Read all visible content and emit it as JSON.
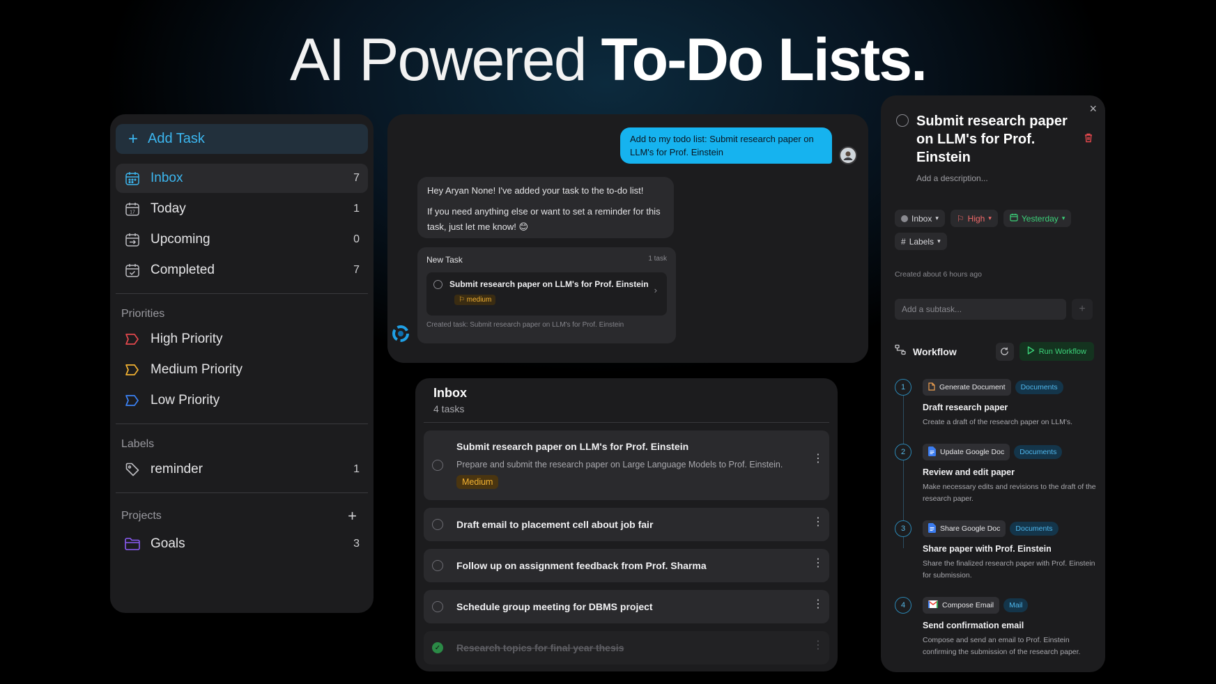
{
  "hero": {
    "light": "AI Powered",
    "bold": "To-Do Lists."
  },
  "sidebar": {
    "add_task": "Add Task",
    "nav": [
      {
        "label": "Inbox",
        "count": "7",
        "icon": "inbox-calendar-icon"
      },
      {
        "label": "Today",
        "count": "1",
        "icon": "today-calendar-icon"
      },
      {
        "label": "Upcoming",
        "count": "0",
        "icon": "upcoming-calendar-icon"
      },
      {
        "label": "Completed",
        "count": "7",
        "icon": "completed-calendar-icon"
      }
    ],
    "priorities_title": "Priorities",
    "priorities": [
      {
        "label": "High Priority",
        "color": "#e5484d"
      },
      {
        "label": "Medium Priority",
        "color": "#f3b232"
      },
      {
        "label": "Low Priority",
        "color": "#3b82f6"
      }
    ],
    "labels_title": "Labels",
    "labels": [
      {
        "label": "reminder",
        "count": "1"
      }
    ],
    "projects_title": "Projects",
    "projects": [
      {
        "label": "Goals",
        "count": "3",
        "color": "#8b5cf6"
      }
    ]
  },
  "chat": {
    "user_message": "Add to my todo list: Submit research paper on LLM's for Prof. Einstein",
    "bot_message_1": "Hey Aryan None! I've added your task to the to-do list!",
    "bot_message_2": "If you need anything else or want to set a reminder for this task, just let me know! 😊",
    "card": {
      "title": "New Task",
      "count": "1 task",
      "task_title": "Submit research paper on LLM's for Prof. Einstein",
      "priority": "medium",
      "footer": "Created task: Submit research paper on LLM's for Prof. Einstein"
    }
  },
  "inbox": {
    "title": "Inbox",
    "subtitle": "4 tasks",
    "tasks": [
      {
        "title": "Submit research paper on LLM's for Prof. Einstein",
        "description": "Prepare and submit the research paper on Large Language Models to Prof. Einstein.",
        "priority": "Medium",
        "done": false
      },
      {
        "title": "Draft email to placement cell about job fair",
        "done": false
      },
      {
        "title": "Follow up on assignment feedback from Prof. Sharma",
        "done": false
      },
      {
        "title": "Schedule group meeting for DBMS project",
        "done": false
      },
      {
        "title": "Research topics for final year thesis",
        "done": true
      }
    ]
  },
  "detail": {
    "title": "Submit research paper on LLM's for Prof. Einstein",
    "description_placeholder": "Add a description...",
    "project": "Inbox",
    "priority": "High",
    "due": "Yesterday",
    "labels": "Labels",
    "created": "Created about 6 hours ago",
    "subtask_placeholder": "Add a subtask...",
    "workflow_title": "Workflow",
    "run_workflow": "Run Workflow",
    "steps": [
      {
        "num": "1",
        "tool": "Generate Document",
        "category": "Documents",
        "title": "Draft research paper",
        "description": "Create a draft of the research paper on LLM's."
      },
      {
        "num": "2",
        "tool": "Update Google Doc",
        "category": "Documents",
        "title": "Review and edit paper",
        "description": "Make necessary edits and revisions to the draft of the research paper."
      },
      {
        "num": "3",
        "tool": "Share Google Doc",
        "category": "Documents",
        "title": "Share paper with Prof. Einstein",
        "description": "Share the finalized research paper with Prof. Einstein for submission."
      },
      {
        "num": "4",
        "tool": "Compose Email",
        "category": "Mail",
        "title": "Send confirmation email",
        "description": "Compose and send an email to Prof. Einstein confirming the submission of the research paper."
      }
    ]
  },
  "colors": {
    "accent": "#3cb6ef",
    "high": "#f36a6a",
    "date_green": "#3cd37a",
    "medium": "#f3b232"
  }
}
